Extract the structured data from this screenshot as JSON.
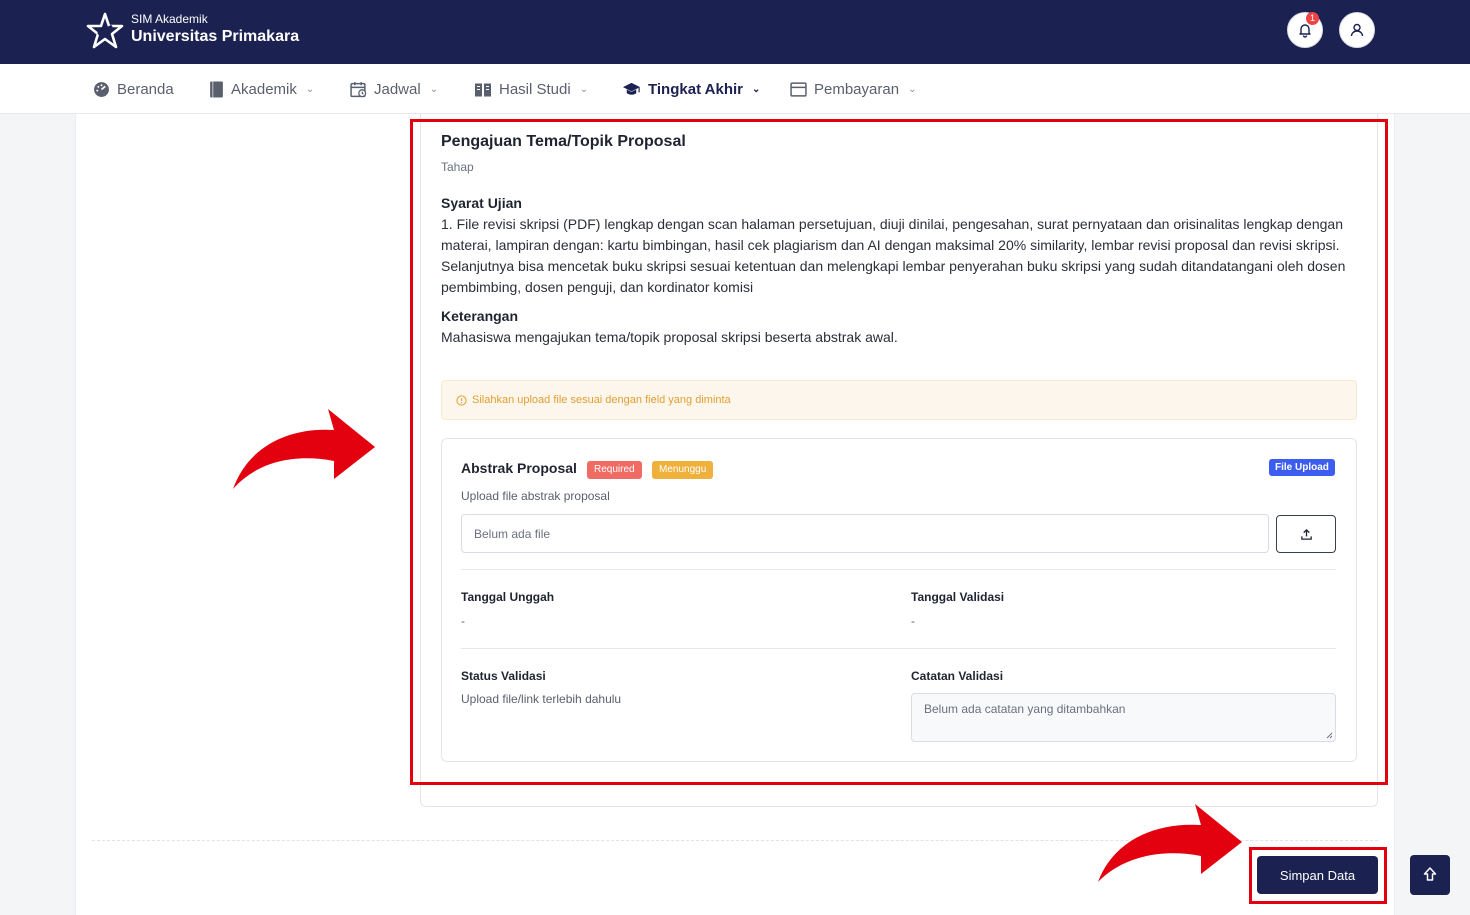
{
  "header": {
    "app_label": "SIM Akademik",
    "institution": "Universitas Primakara",
    "notification_count": "1",
    "logo_icon": "primakara-star-logo",
    "bell_icon": "bell-icon",
    "user_icon": "user-icon"
  },
  "nav": {
    "items": [
      {
        "label": "Beranda",
        "icon": "dashboard-icon",
        "dropdown": false
      },
      {
        "label": "Akademik",
        "icon": "book-icon",
        "dropdown": true
      },
      {
        "label": "Jadwal",
        "icon": "calendar-icon",
        "dropdown": true
      },
      {
        "label": "Hasil Studi",
        "icon": "open-book-icon",
        "dropdown": true
      },
      {
        "label": "Tingkat Akhir",
        "icon": "graduation-cap-icon",
        "dropdown": true,
        "active": true
      },
      {
        "label": "Pembayaran",
        "icon": "card-icon",
        "dropdown": true
      }
    ]
  },
  "stage": {
    "title": "Pengajuan Tema/Topik Proposal",
    "subtitle": "Tahap",
    "requirements_title": "Syarat Ujian",
    "requirements_text": "1. File revisi skripsi (PDF) lengkap dengan scan halaman persetujuan, diuji dinilai, pengesahan, surat pernyataan dan orisinalitas lengkap dengan materai, lampiran dengan: kartu bimbingan, hasil cek plagiarism dan AI dengan maksimal 20% similarity, lembar revisi proposal dan revisi skripsi. Selanjutnya bisa mencetak buku skripsi sesuai ketentuan dan melengkapi lembar penyerahan buku skripsi yang sudah ditandatangani oleh dosen pembimbing, dosen penguji, dan kordinator komisi",
    "notes_title": "Keterangan",
    "notes_text": "Mahasiswa mengajukan tema/topik proposal skripsi beserta abstrak awal."
  },
  "alert": {
    "text": "Silahkan upload file sesuai dengan field yang diminta",
    "icon": "info-circle-icon"
  },
  "upload_item": {
    "title": "Abstrak Proposal",
    "required_badge": "Required",
    "status_badge": "Menunggu",
    "type_badge": "File Upload",
    "description": "Upload file abstrak proposal",
    "file_placeholder": "Belum ada file",
    "upload_icon": "upload-icon",
    "upload_date_label": "Tanggal Unggah",
    "upload_date_value": "-",
    "validation_date_label": "Tanggal Validasi",
    "validation_date_value": "-",
    "validation_status_label": "Status Validasi",
    "validation_status_value": "Upload file/link terlebih dahulu",
    "validation_notes_label": "Catatan Validasi",
    "validation_notes_placeholder": "Belum ada catatan yang ditambahkan"
  },
  "footer": {
    "save_label": "Simpan Data",
    "scroll_top_icon": "arrow-up-icon"
  },
  "colors": {
    "primary": "#1b2150",
    "required": "#ef6b63",
    "waiting": "#f0b03c",
    "file_upload": "#3d5cf0",
    "annotation": "#e3000f",
    "alert_text": "#e0a030"
  }
}
